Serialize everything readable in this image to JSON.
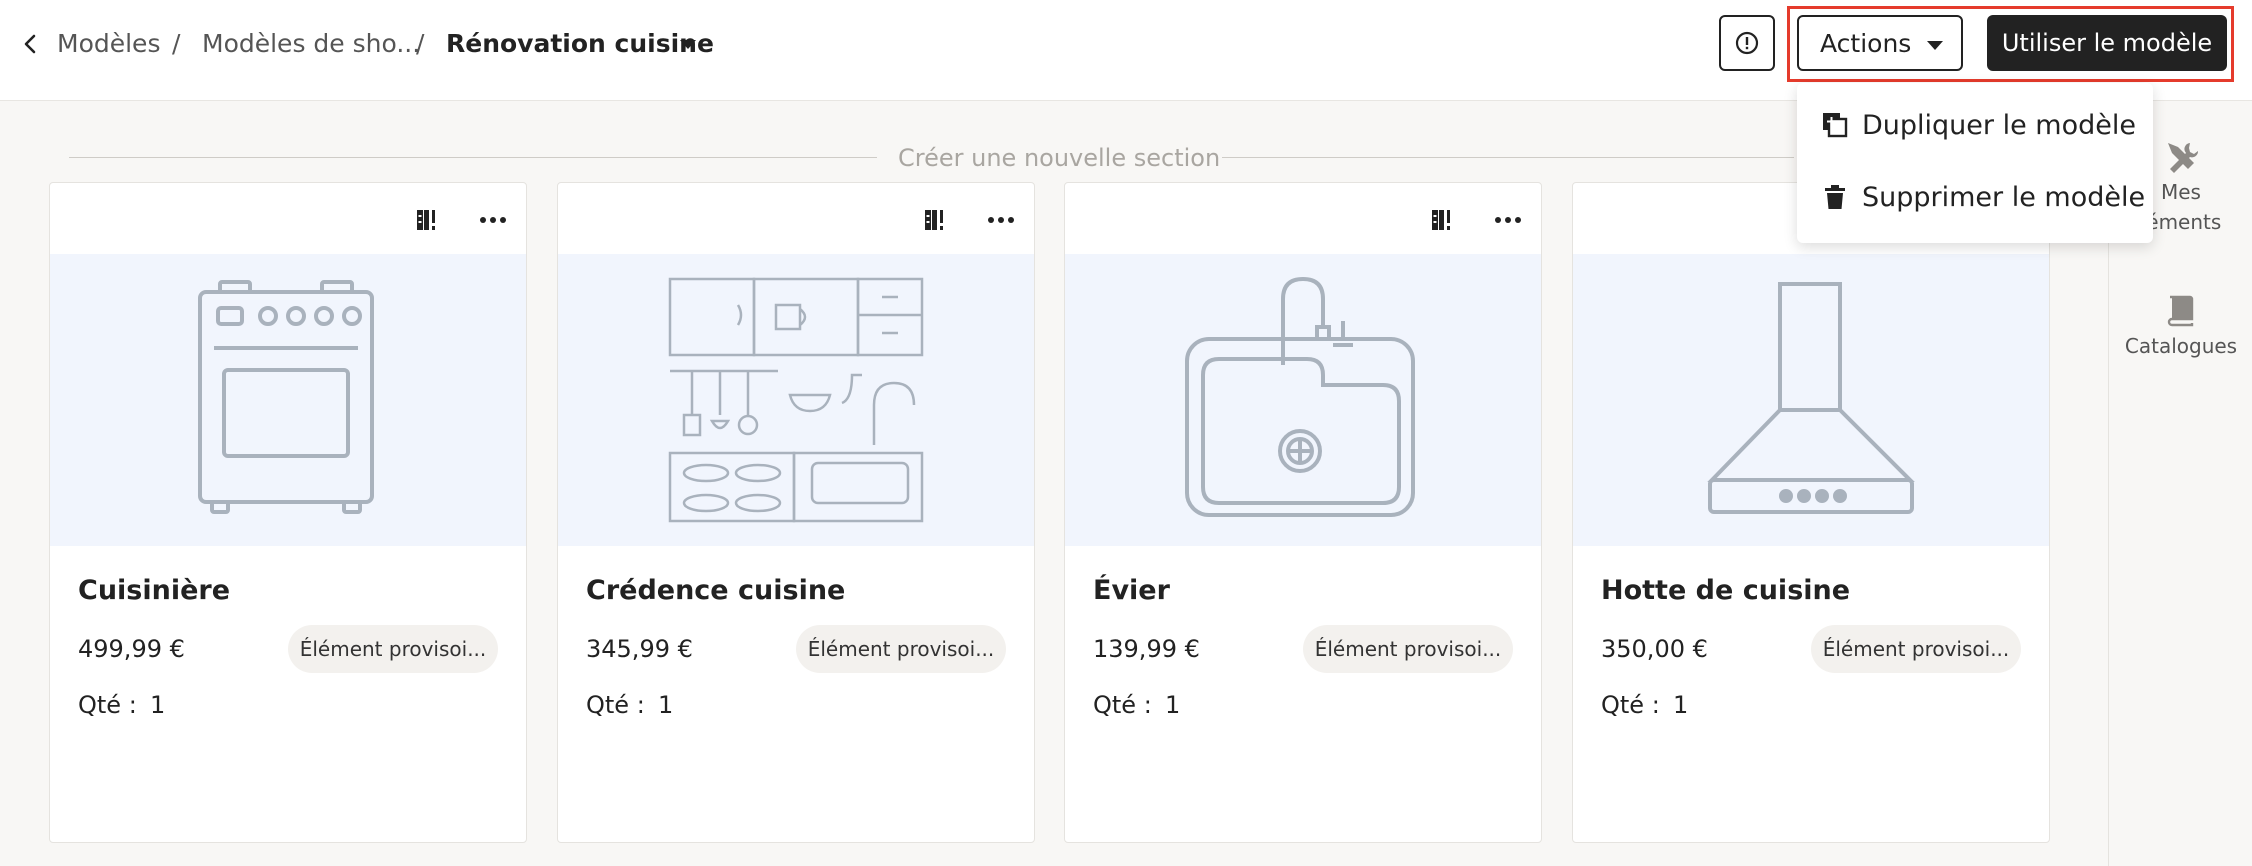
{
  "breadcrumb": {
    "items": [
      "Modèles",
      "Modèles de sho...",
      "Rénovation cuisine"
    ],
    "separator": "/"
  },
  "header": {
    "actions_label": "Actions",
    "use_template_label": "Utiliser le modèle"
  },
  "actions_menu": {
    "items": [
      {
        "label": "Dupliquer le modèle",
        "icon": "duplicate-icon"
      },
      {
        "label": "Supprimer le modèle",
        "icon": "trash-icon"
      }
    ]
  },
  "section": {
    "create_label": "Créer une nouvelle section"
  },
  "cards": [
    {
      "title": "Cuisinière",
      "price": "499,99 €",
      "badge": "Élément provisoi...",
      "qty_label": "Qté :",
      "qty": "1",
      "image_icon": "stove-icon"
    },
    {
      "title": "Crédence cuisine",
      "price": "345,99 €",
      "badge": "Élément provisoi...",
      "qty_label": "Qté :",
      "qty": "1",
      "image_icon": "kitchen-backsplash-icon"
    },
    {
      "title": "Évier",
      "price": "139,99 €",
      "badge": "Élément provisoi...",
      "qty_label": "Qté :",
      "qty": "1",
      "image_icon": "sink-icon"
    },
    {
      "title": "Hotte de cuisine",
      "price": "350,00 €",
      "badge": "Élément provisoi...",
      "qty_label": "Qté :",
      "qty": "1",
      "image_icon": "range-hood-icon"
    }
  ],
  "sidebar": {
    "items": [
      {
        "label_line1": "Mes",
        "label_line2": "léments",
        "icon": "tools-icon"
      },
      {
        "label_line1": "Catalogues",
        "icon": "book-icon"
      }
    ]
  },
  "colors": {
    "primary_dark": "#222222",
    "highlight": "#e53b2c",
    "image_bg": "#f1f5fd",
    "icon_stroke": "#a9b2bd"
  }
}
